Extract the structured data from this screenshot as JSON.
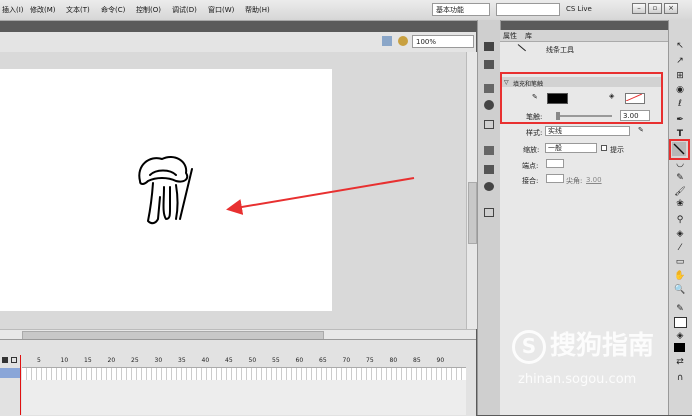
{
  "menu": [
    "插入(I)",
    "修改(M)",
    "文本(T)",
    "命令(C)",
    "控制(O)",
    "调试(D)",
    "窗口(W)",
    "帮助(H)"
  ],
  "workspace": "基本功能",
  "cs_live": "CS Live",
  "zoom": "100%",
  "panel_tabs": [
    "属性",
    "库"
  ],
  "tool_name": "线条工具",
  "section_fill_stroke": "填充和笔触",
  "stroke_label": "笔触:",
  "stroke_value": "3.00",
  "style_label": "样式:",
  "style_value": "实线",
  "scale_label": "缩放:",
  "scale_value": "一般",
  "hint_label": "提示",
  "cap_label": "端点:",
  "join_label": "接合:",
  "miter_label": "尖角:",
  "miter_value": "3.00",
  "timeline_label": "",
  "frame_numbers": [
    "5",
    "10",
    "15",
    "20",
    "25",
    "30",
    "35",
    "40",
    "45",
    "50",
    "55",
    "60",
    "65",
    "70",
    "75",
    "80",
    "85",
    "90"
  ],
  "watermark": "搜狗指南",
  "watermark_url": "zhinan.sogou.com",
  "colors": {
    "stroke": "#000000",
    "annotation": "#e83030"
  }
}
